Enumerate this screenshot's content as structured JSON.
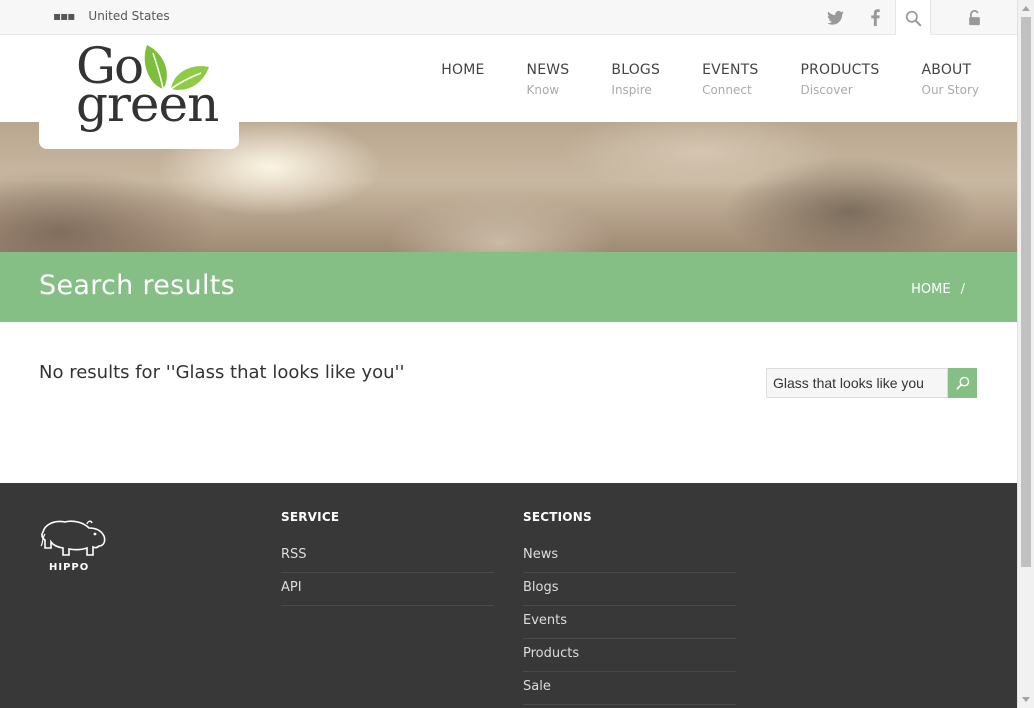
{
  "topbar": {
    "locale_icon": "more-dots-icon",
    "locale": "United States",
    "icons": [
      "twitter-icon",
      "facebook-icon",
      "search-icon",
      "lock-icon"
    ]
  },
  "logo": {
    "line1": "Go",
    "line2": "green",
    "icon": "leaves-icon"
  },
  "nav": [
    {
      "label": "HOME",
      "sub": ""
    },
    {
      "label": "NEWS",
      "sub": "Know"
    },
    {
      "label": "BLOGS",
      "sub": "Inspire"
    },
    {
      "label": "EVENTS",
      "sub": "Connect"
    },
    {
      "label": "PRODUCTS",
      "sub": "Discover"
    },
    {
      "label": "ABOUT",
      "sub": "Our Story"
    }
  ],
  "band": {
    "title": "Search results",
    "breadcrumb_home": "HOME",
    "breadcrumb_sep": "/"
  },
  "results": {
    "message": "No results for ''Glass that looks like you''"
  },
  "search": {
    "value": "Glass that looks like you",
    "button_icon": "search-icon"
  },
  "footer": {
    "brand": "HIPPO",
    "brand_icon": "hippo-icon",
    "service": {
      "heading": "SERVICE",
      "items": [
        "RSS",
        "API"
      ]
    },
    "sections": {
      "heading": "SECTIONS",
      "items": [
        "News",
        "Blogs",
        "Events",
        "Products",
        "Sale"
      ]
    }
  },
  "colors": {
    "accent_green": "#86bf86",
    "footer_bg": "#383838"
  }
}
